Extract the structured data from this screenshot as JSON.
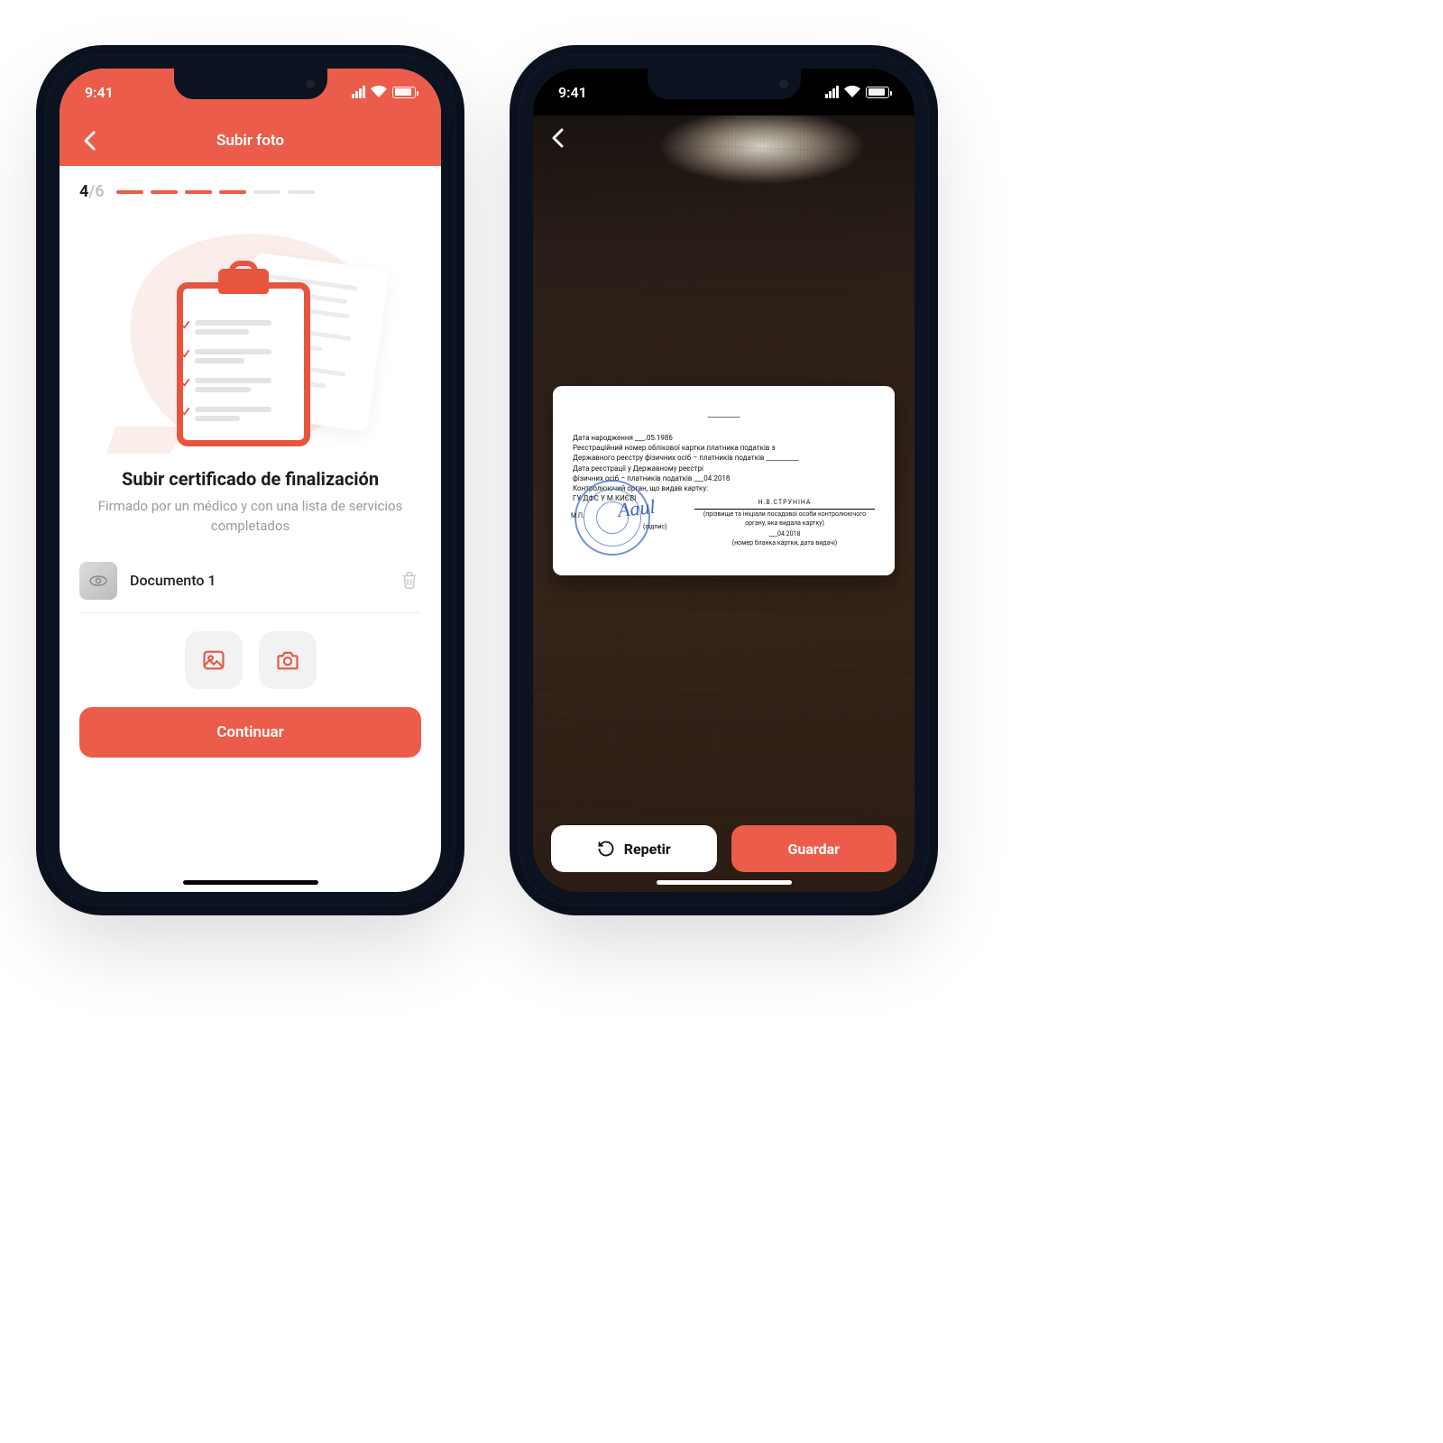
{
  "colors": {
    "accent": "#EB5D4A"
  },
  "status": {
    "time": "9:41"
  },
  "left": {
    "header_title": "Subir foto",
    "step": {
      "current": "4",
      "sep": "/",
      "total": "6",
      "active": 4,
      "count": 6
    },
    "heading": "Subir certificado de finalización",
    "subtext": "Firmado por un médico y con una lista de servicios completados",
    "document": {
      "name": "Documento 1"
    },
    "buttons": {
      "gallery": "gallery",
      "camera": "camera"
    },
    "cta": "Continuar"
  },
  "right": {
    "card": {
      "line1": "Дата народження ___.05.1986",
      "line2": "Реєстраційний номер облікової картки платника податків з",
      "line3": "Державного реєстру фізичних осіб – платників податків __________",
      "line4": "Дата реєстрації у Державному реєстрі",
      "line5": "фізичних осіб – платників податків  ___04.2018",
      "line6": "Контролюючий орган, що видав картку:",
      "line7": "ГУ ДФС У М.КИЄВІ",
      "sig_label": "(підпис)",
      "mp": "М.П.",
      "name": "Н.В.СТРУНІНА",
      "hint1": "(прізвище та ініціали посадової особи контролюючого органу, яка видала картку)",
      "date2": "___04.2018",
      "hint2": "(номер бланка картки, дата видачі)"
    },
    "buttons": {
      "retry": "Repetir",
      "save": "Guardar"
    }
  }
}
